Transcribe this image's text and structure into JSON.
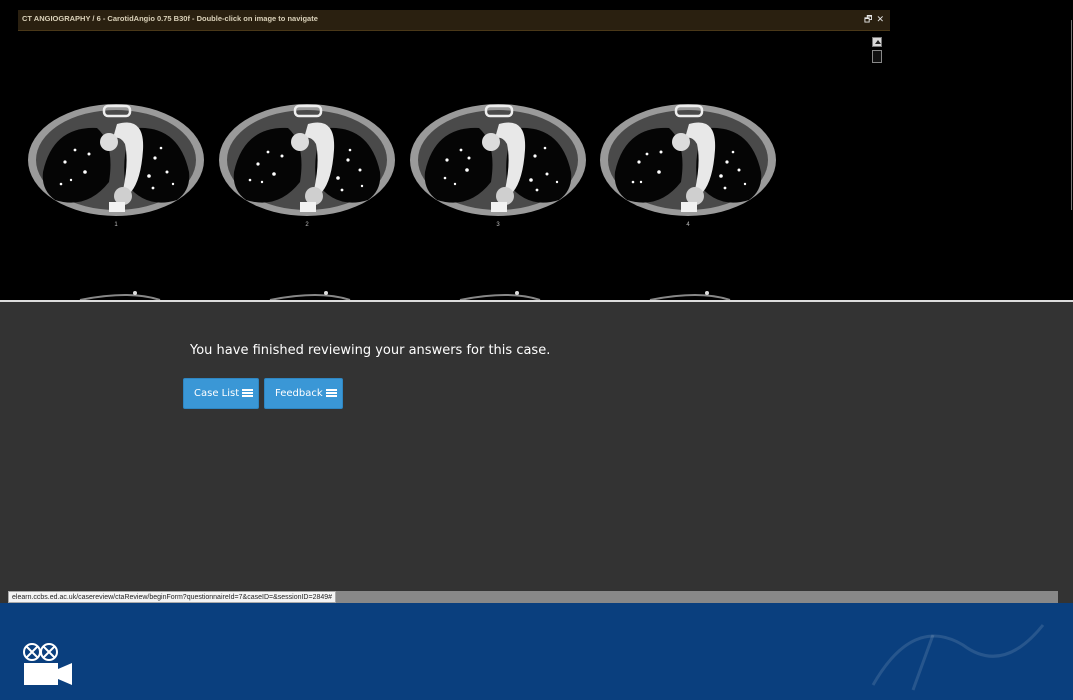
{
  "viewer": {
    "title": "CT ANGIOGRAPHY / 6 - CarotidAngio 0.75 B30f - Double-click on image to navigate",
    "maximize_glyph": "🗗",
    "close_glyph": "✕",
    "thumbnails": [
      {
        "number": "1"
      },
      {
        "number": "2"
      },
      {
        "number": "3"
      },
      {
        "number": "4"
      }
    ]
  },
  "panel": {
    "message": "You have finished reviewing your answers for this case.",
    "case_list_label": "Case List",
    "feedback_label": "Feedback",
    "button_color": "#3a97d6",
    "background_color": "#333333"
  },
  "status_bar": {
    "url": "elearn.ccbs.ed.ac.uk/casereview/ctaReview/beginForm?questionnaireId=7&caseID=&sessionID=2849#"
  },
  "footer": {
    "background_color": "#0a3f7e",
    "icon": "video-camera-icon"
  }
}
